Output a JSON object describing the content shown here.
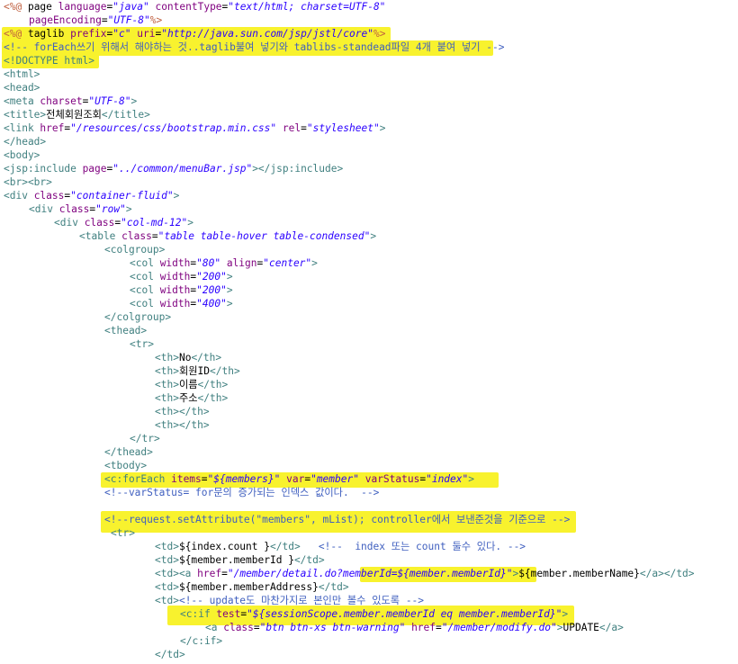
{
  "editor": {
    "highlight_color": "#f8f22e",
    "lines": [
      {
        "indent": 0,
        "tokens": [
          [
            "dir",
            "<%@ "
          ],
          [
            "txt",
            "page "
          ],
          [
            "attr",
            "language"
          ],
          [
            "txt",
            "="
          ],
          [
            "val",
            "\"java\""
          ],
          [
            "txt",
            " "
          ],
          [
            "attr",
            "contentType"
          ],
          [
            "txt",
            "="
          ],
          [
            "val",
            "\"text/html; charset=UTF-8\""
          ]
        ]
      },
      {
        "indent": 4,
        "tokens": [
          [
            "attr",
            "pageEncoding"
          ],
          [
            "txt",
            "="
          ],
          [
            "val",
            "\"UTF-8\""
          ],
          [
            "dir",
            "%>"
          ]
        ]
      },
      {
        "indent": 0,
        "tokens": [
          [
            "dir",
            "<%@ "
          ],
          [
            "txt",
            "taglib "
          ],
          [
            "attr",
            "prefix"
          ],
          [
            "txt",
            "="
          ],
          [
            "val",
            "\"c\""
          ],
          [
            "txt",
            " "
          ],
          [
            "attr",
            "uri"
          ],
          [
            "txt",
            "="
          ],
          [
            "val",
            "\"http://java.sun.com/jsp/jstl/core\""
          ],
          [
            "dir",
            "%>"
          ]
        ]
      },
      {
        "indent": 0,
        "tokens": [
          [
            "cmt",
            "<!-- forEach쓰기 위해서 해야하는 것..taglib불여 넣기와 tablibs-standead파일 4개 붙여 넣기 -->"
          ]
        ]
      },
      {
        "indent": 0,
        "tokens": [
          [
            "tag",
            "<!DOCTYPE html>"
          ]
        ]
      },
      {
        "indent": 0,
        "tokens": [
          [
            "tag",
            "<html>"
          ]
        ]
      },
      {
        "indent": 0,
        "tokens": [
          [
            "tag",
            "<head>"
          ]
        ]
      },
      {
        "indent": 0,
        "tokens": [
          [
            "tag",
            "<meta "
          ],
          [
            "attr",
            "charset"
          ],
          [
            "txt",
            "="
          ],
          [
            "val",
            "\"UTF-8\""
          ],
          [
            "tag",
            ">"
          ]
        ]
      },
      {
        "indent": 0,
        "tokens": [
          [
            "tag",
            "<title>"
          ],
          [
            "txt",
            "전체회원조회"
          ],
          [
            "tag",
            "</title>"
          ]
        ]
      },
      {
        "indent": 0,
        "tokens": [
          [
            "tag",
            "<link "
          ],
          [
            "attr",
            "href"
          ],
          [
            "txt",
            "="
          ],
          [
            "val",
            "\"/resources/css/bootstrap.min.css\""
          ],
          [
            "txt",
            " "
          ],
          [
            "attr",
            "rel"
          ],
          [
            "txt",
            "="
          ],
          [
            "val",
            "\"stylesheet\""
          ],
          [
            "tag",
            ">"
          ]
        ]
      },
      {
        "indent": 0,
        "tokens": [
          [
            "tag",
            "</head>"
          ]
        ]
      },
      {
        "indent": 0,
        "tokens": [
          [
            "tag",
            "<body>"
          ]
        ]
      },
      {
        "indent": 0,
        "tokens": [
          [
            "tag",
            "<jsp:include "
          ],
          [
            "attr",
            "page"
          ],
          [
            "txt",
            "="
          ],
          [
            "val",
            "\"../common/menuBar.jsp\""
          ],
          [
            "tag",
            "></jsp:include>"
          ]
        ]
      },
      {
        "indent": 0,
        "tokens": [
          [
            "tag",
            "<br><br>"
          ]
        ]
      },
      {
        "indent": 0,
        "tokens": [
          [
            "tag",
            "<div "
          ],
          [
            "attr",
            "class"
          ],
          [
            "txt",
            "="
          ],
          [
            "val",
            "\"container-fluid\""
          ],
          [
            "tag",
            ">"
          ]
        ]
      },
      {
        "indent": 4,
        "tokens": [
          [
            "tag",
            "<div "
          ],
          [
            "attr",
            "class"
          ],
          [
            "txt",
            "="
          ],
          [
            "val",
            "\"row\""
          ],
          [
            "tag",
            ">"
          ]
        ]
      },
      {
        "indent": 8,
        "tokens": [
          [
            "tag",
            "<div "
          ],
          [
            "attr",
            "class"
          ],
          [
            "txt",
            "="
          ],
          [
            "val",
            "\"col-md-12\""
          ],
          [
            "tag",
            ">"
          ]
        ]
      },
      {
        "indent": 12,
        "tokens": [
          [
            "tag",
            "<table "
          ],
          [
            "attr",
            "class"
          ],
          [
            "txt",
            "="
          ],
          [
            "val",
            "\"table table-hover table-condensed\""
          ],
          [
            "tag",
            ">"
          ]
        ]
      },
      {
        "indent": 16,
        "tokens": [
          [
            "tag",
            "<colgroup>"
          ]
        ]
      },
      {
        "indent": 20,
        "tokens": [
          [
            "tag",
            "<col "
          ],
          [
            "attr",
            "width"
          ],
          [
            "txt",
            "="
          ],
          [
            "val",
            "\"80\""
          ],
          [
            "txt",
            " "
          ],
          [
            "attr",
            "align"
          ],
          [
            "txt",
            "="
          ],
          [
            "val",
            "\"center\""
          ],
          [
            "tag",
            ">"
          ]
        ]
      },
      {
        "indent": 20,
        "tokens": [
          [
            "tag",
            "<col "
          ],
          [
            "attr",
            "width"
          ],
          [
            "txt",
            "="
          ],
          [
            "val",
            "\"200\""
          ],
          [
            "tag",
            ">"
          ]
        ]
      },
      {
        "indent": 20,
        "tokens": [
          [
            "tag",
            "<col "
          ],
          [
            "attr",
            "width"
          ],
          [
            "txt",
            "="
          ],
          [
            "val",
            "\"200\""
          ],
          [
            "tag",
            ">"
          ]
        ]
      },
      {
        "indent": 20,
        "tokens": [
          [
            "tag",
            "<col "
          ],
          [
            "attr",
            "width"
          ],
          [
            "txt",
            "="
          ],
          [
            "val",
            "\"400\""
          ],
          [
            "tag",
            ">"
          ]
        ]
      },
      {
        "indent": 16,
        "tokens": [
          [
            "tag",
            "</colgroup>"
          ]
        ]
      },
      {
        "indent": 16,
        "tokens": [
          [
            "tag",
            "<thead>"
          ]
        ]
      },
      {
        "indent": 20,
        "tokens": [
          [
            "tag",
            "<tr>"
          ]
        ]
      },
      {
        "indent": 24,
        "tokens": [
          [
            "tag",
            "<th>"
          ],
          [
            "txt",
            "No"
          ],
          [
            "tag",
            "</th>"
          ]
        ]
      },
      {
        "indent": 24,
        "tokens": [
          [
            "tag",
            "<th>"
          ],
          [
            "txt",
            "회원ID"
          ],
          [
            "tag",
            "</th>"
          ]
        ]
      },
      {
        "indent": 24,
        "tokens": [
          [
            "tag",
            "<th>"
          ],
          [
            "txt",
            "이름"
          ],
          [
            "tag",
            "</th>"
          ]
        ]
      },
      {
        "indent": 24,
        "tokens": [
          [
            "tag",
            "<th>"
          ],
          [
            "txt",
            "주소"
          ],
          [
            "tag",
            "</th>"
          ]
        ]
      },
      {
        "indent": 24,
        "tokens": [
          [
            "tag",
            "<th></th>"
          ]
        ]
      },
      {
        "indent": 24,
        "tokens": [
          [
            "tag",
            "<th></th>"
          ]
        ]
      },
      {
        "indent": 20,
        "tokens": [
          [
            "tag",
            "</tr>"
          ]
        ]
      },
      {
        "indent": 16,
        "tokens": [
          [
            "tag",
            "</thead>"
          ]
        ]
      },
      {
        "indent": 16,
        "tokens": [
          [
            "tag",
            "<tbody>"
          ]
        ]
      },
      {
        "indent": 16,
        "tokens": [
          [
            "tag",
            "<c:forEach "
          ],
          [
            "attr",
            "items"
          ],
          [
            "txt",
            "="
          ],
          [
            "val",
            "\"${members}\""
          ],
          [
            "txt",
            " "
          ],
          [
            "attr",
            "var"
          ],
          [
            "txt",
            "="
          ],
          [
            "val",
            "\"member\""
          ],
          [
            "txt",
            " "
          ],
          [
            "attr",
            "varStatus"
          ],
          [
            "txt",
            "="
          ],
          [
            "val",
            "\"index\""
          ],
          [
            "tag",
            ">"
          ]
        ]
      },
      {
        "indent": 16,
        "tokens": [
          [
            "cmt",
            "<!--varStatus= for문의 증가되는 인덱스 값이다.  -->"
          ]
        ]
      },
      {
        "indent": 0,
        "tokens": [
          [
            "txt",
            ""
          ]
        ]
      },
      {
        "indent": 16,
        "tokens": [
          [
            "cmt",
            "<!--request.setAttribute(\"members\", mList); controller에서 보낸준것을 기준으로 -->"
          ]
        ]
      },
      {
        "indent": 17,
        "tokens": [
          [
            "tag",
            "<tr>"
          ]
        ]
      },
      {
        "indent": 24,
        "tokens": [
          [
            "tag",
            "<td>"
          ],
          [
            "txt",
            "${index.count }"
          ],
          [
            "tag",
            "</td>"
          ],
          [
            "txt",
            "   "
          ],
          [
            "cmt",
            "<!--  index 또는 count 둘수 있다. -->"
          ]
        ]
      },
      {
        "indent": 24,
        "tokens": [
          [
            "tag",
            "<td>"
          ],
          [
            "txt",
            "${member.memberId }"
          ],
          [
            "tag",
            "</td>"
          ]
        ]
      },
      {
        "indent": 24,
        "tokens": [
          [
            "tag",
            "<td><a "
          ],
          [
            "attr",
            "href"
          ],
          [
            "txt",
            "="
          ],
          [
            "val",
            "\"/member/detail.do?memberId=${member.memberId}\""
          ],
          [
            "tag",
            ">"
          ],
          [
            "txt",
            "${member.memberName}"
          ],
          [
            "tag",
            "</a></td>"
          ]
        ]
      },
      {
        "indent": 24,
        "tokens": [
          [
            "tag",
            "<td>"
          ],
          [
            "txt",
            "${member.memberAddress}"
          ],
          [
            "tag",
            "</td>"
          ]
        ]
      },
      {
        "indent": 24,
        "tokens": [
          [
            "tag",
            "<td>"
          ],
          [
            "cmt",
            "<!-- update도 마찬가지로 본인만 볼수 있도록 -->"
          ]
        ]
      },
      {
        "indent": 28,
        "tokens": [
          [
            "tag",
            "<c:if "
          ],
          [
            "attr",
            "test"
          ],
          [
            "txt",
            "="
          ],
          [
            "val",
            "\"${sessionScope.member.memberId eq member.memberId}\""
          ],
          [
            "tag",
            ">"
          ]
        ]
      },
      {
        "indent": 32,
        "tokens": [
          [
            "tag",
            "<a "
          ],
          [
            "attr",
            "class"
          ],
          [
            "txt",
            "="
          ],
          [
            "val",
            "\"btn btn-xs btn-warning\""
          ],
          [
            "txt",
            " "
          ],
          [
            "attr",
            "href"
          ],
          [
            "txt",
            "="
          ],
          [
            "val",
            "\"/member/modify.do\""
          ],
          [
            "tag",
            ">"
          ],
          [
            "txt",
            "UPDATE"
          ],
          [
            "tag",
            "</a>"
          ]
        ]
      },
      {
        "indent": 28,
        "tokens": [
          [
            "tag",
            "</c:if>"
          ]
        ]
      },
      {
        "indent": 24,
        "tokens": [
          [
            "tag",
            "</td>"
          ]
        ]
      }
    ]
  }
}
